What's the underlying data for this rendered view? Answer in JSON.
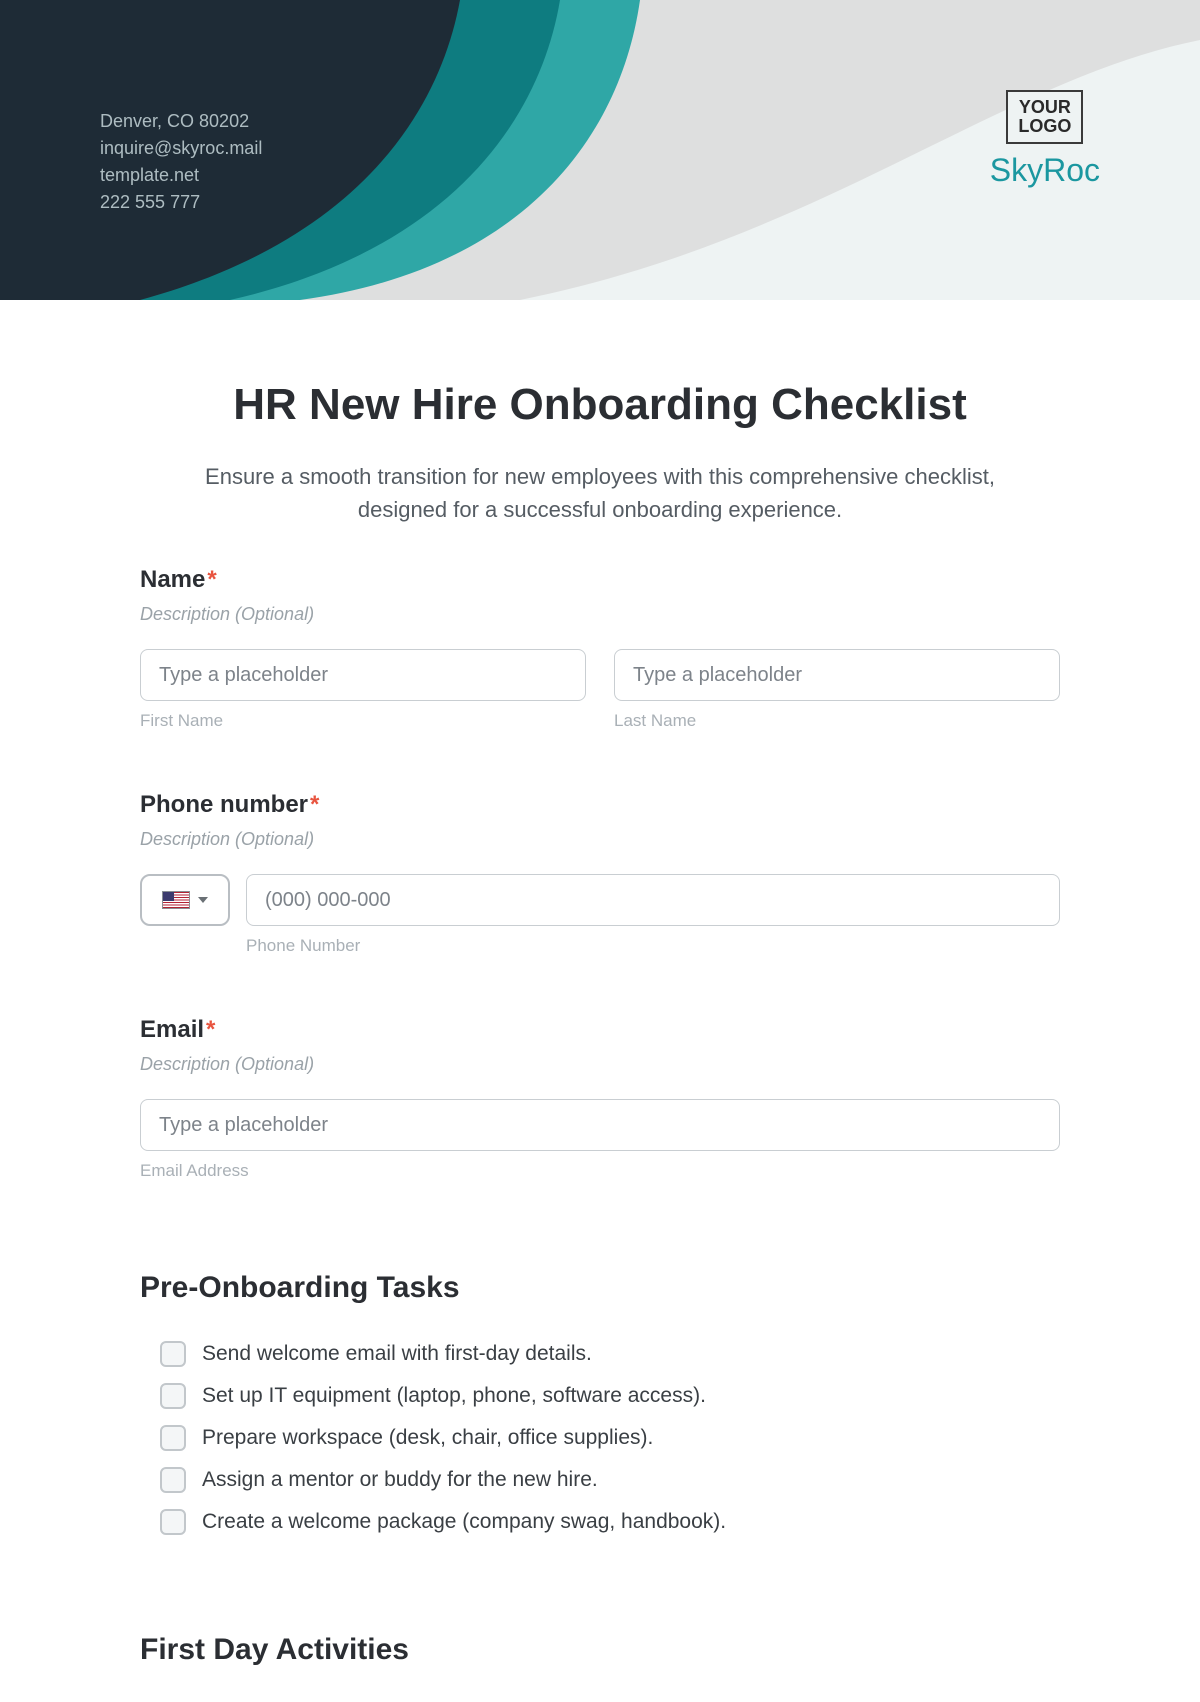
{
  "header": {
    "contact": {
      "address": "Denver, CO 80202",
      "email": "inquire@skyroc.mail",
      "site": "template.net",
      "phone": "222 555 777"
    },
    "logo_line1": "YOUR",
    "logo_line2": "LOGO",
    "brand": "SkyRoc"
  },
  "page": {
    "title": "HR New Hire Onboarding Checklist",
    "subtitle": "Ensure a smooth transition for new employees with this comprehensive checklist, designed for a successful onboarding experience."
  },
  "fields": {
    "name": {
      "label": "Name",
      "desc": "Description (Optional)",
      "first_placeholder": "Type a placeholder",
      "first_sub": "First Name",
      "last_placeholder": "Type a placeholder",
      "last_sub": "Last Name"
    },
    "phone": {
      "label": "Phone number",
      "desc": "Description (Optional)",
      "placeholder": "(000) 000-000",
      "sub": "Phone Number"
    },
    "email": {
      "label": "Email",
      "desc": "Description (Optional)",
      "placeholder": "Type a placeholder",
      "sub": "Email Address"
    }
  },
  "sections": {
    "pre": {
      "title": "Pre-Onboarding Tasks",
      "items": [
        "Send welcome email with first-day details.",
        "Set up IT equipment (laptop, phone, software access).",
        "Prepare workspace (desk, chair, office supplies).",
        "Assign a mentor or buddy for the new hire.",
        "Create a welcome package (company swag, handbook)."
      ]
    },
    "firstday": {
      "title": "First Day Activities"
    }
  }
}
